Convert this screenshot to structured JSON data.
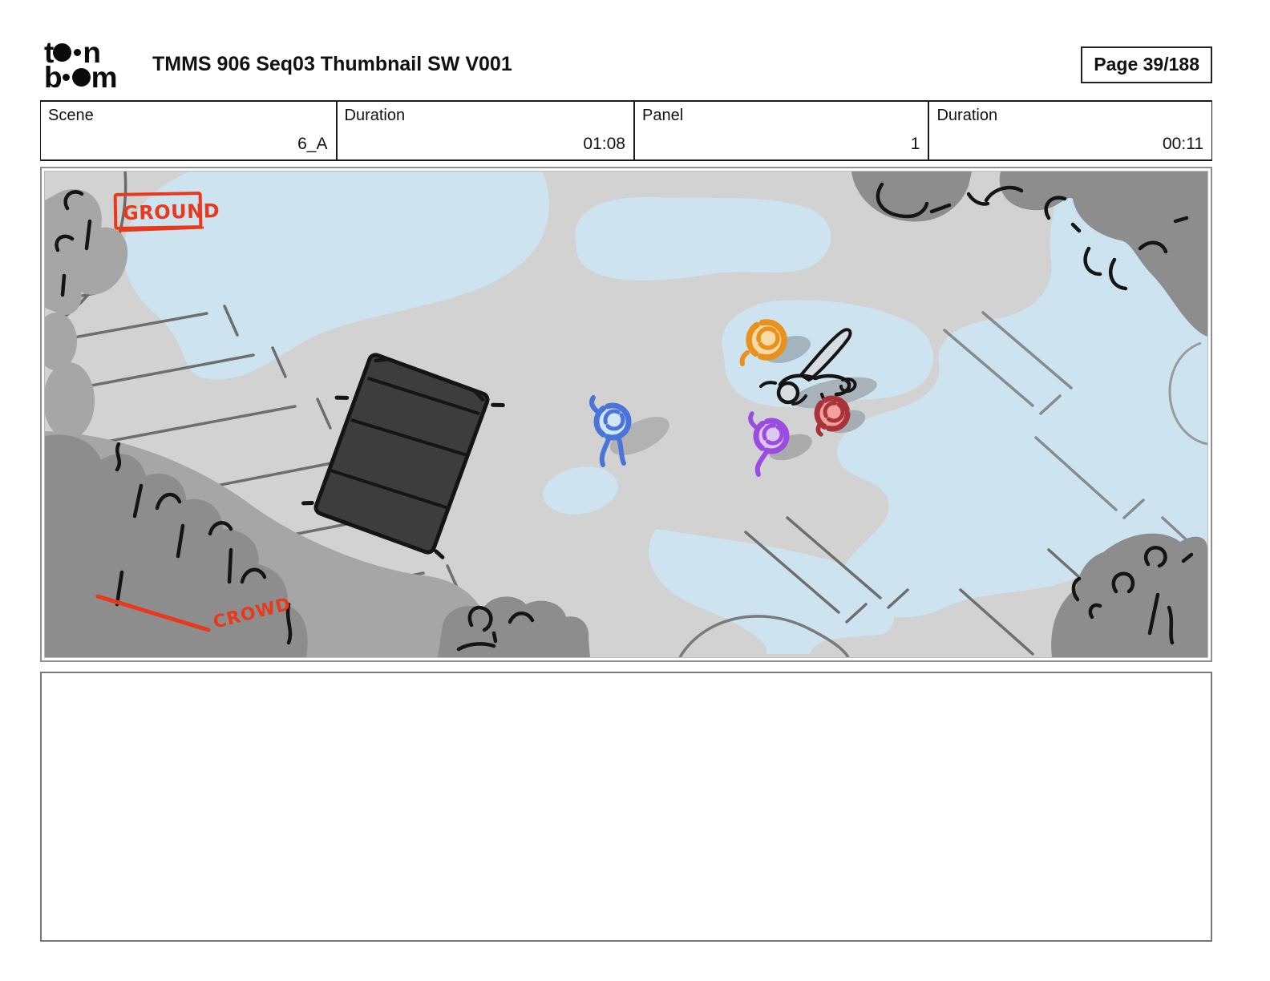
{
  "header": {
    "logo": {
      "alt": "toon boom",
      "line1_start": "t",
      "line1_end": "n",
      "line2_start": "b",
      "line2_end": "m"
    },
    "title": "TMMS 906 Seq03 Thumbnail SW V001",
    "page_label": "Page 39/188"
  },
  "info_row": [
    {
      "label": "Scene",
      "value": "6_A"
    },
    {
      "label": "Duration",
      "value": "01:08"
    },
    {
      "label": "Panel",
      "value": "1"
    },
    {
      "label": "Duration",
      "value": "00:11"
    }
  ],
  "panel": {
    "annotations": {
      "ground": "GROUND",
      "crowd": "CROWD"
    },
    "colors": {
      "annotation_red": "#e8391c",
      "ground_gray": "#d2d2d2",
      "puddle_blue": "#cde3f0",
      "tree_gray": "#8d8d8d",
      "tree_gray_light": "#a6a6a6",
      "sketch_black": "#141414",
      "parking_line_gray": "#6e6e6e",
      "dumpster_fill": "#3d3d3d",
      "char_orange_outline": "#e8921e",
      "char_orange_fill": "#fbd9a8",
      "char_blue_outline": "#4a74d8",
      "char_blue_fill": "#cfe7f8",
      "char_purple_outline": "#9a4ce0",
      "char_purple_fill": "#dcc6f2",
      "char_red_outline": "#a8333a",
      "char_red_fill": "#f4a09b"
    }
  },
  "caption_box": {
    "value": ""
  }
}
